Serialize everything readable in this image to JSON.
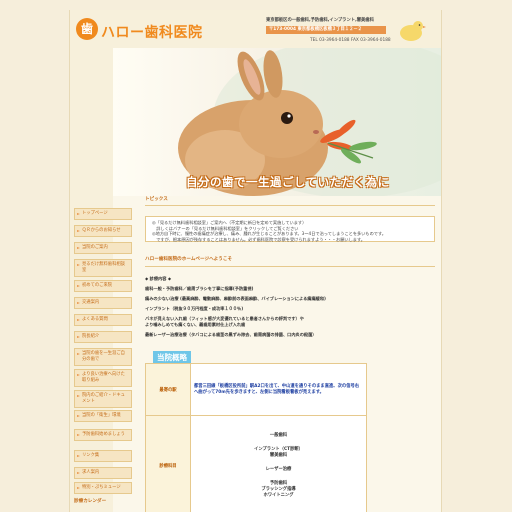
{
  "header": {
    "logo_glyph": "歯",
    "title": "ハロー歯科医院",
    "line1": "東京都板区の一般歯科,予防歯科,インプラント,審美歯科",
    "line2": "〒173-0004 東京都板橋区板橋３丁目１２－２",
    "line3": "TEL 03-3964-0188   FAX 03-3964-0188"
  },
  "hero": {
    "caption": "自分の歯で一生過ごしていただく為に"
  },
  "sidebar": {
    "items": [
      "トップページ",
      "ＱＲからのお知らせ",
      "当院のご案内",
      "見るだけ無料歯科相談室",
      "初めてのご来院",
      "交通案内",
      "よくある質問",
      "院長紹介",
      "当院の歯を一生涯ご自分の歯で",
      "より良い治療へ向けた取り組み",
      "院内のご紹介・ドキュメント",
      "当院の「衛生」環境",
      "予防歯科始めましょう",
      "リンク集",
      "求人案内",
      "特別・ぷちミュージ"
    ],
    "calendar_label": "診療カレンダー"
  },
  "main": {
    "topics_title": "トピックス",
    "topics_lines": [
      "◎「見るだけ無料歯科相談室」ご案内へ（不定期に新日を定めて実施しています）",
      "　詳しくはバナーの「見るだけ無料歯科相談室」をクリックしてご覧ください",
      "◎地方自下時に、慢性の歯痛症が治療し、痛み、腫れが生じることがあります。3〜4日で治ってしまうことを多いものです。",
      "　ですが、根本原因が残存することはありません。必ず歯科医院で診察を受けられますよう・・・お願いします。"
    ],
    "hello_title": "ハロー歯科医院のホームページへようこそ",
    "body_lines": [
      "◆ 診療内容 ◆",
      "歯科一般・予防歯科／歯周ブラシを丁寧に指導(予防重視)",
      "痛みの少ない治療 (最高麻酔、電動麻酔、麻酔前の表面麻酔、バイブレーションによる痛痛緩和)",
      "インプラント（税抜９０万円程度・成功率１００％)",
      "バネが見えない入れ歯（フィット感が大変優れていると患者さんからの評判です）や",
      "より噛みしめても痛くない、義歯用素材仕上げ入れ歯",
      "最新レーザー治療治療（タバコによる歯茎の黒ずみ除去、歯周病菌の排菌、口内炎の殺菌）"
    ],
    "table_title": "当院概略",
    "table": {
      "access_label": "最寄の駅",
      "access_value": "都営三田線「板橋区役所前」駅A2口を出て、中山道を通りそのまま直進、次の信号右へ曲がって70m先を歩きますと、左側に当院看板看板が見えます。",
      "dept_label": "診療科目",
      "dept_values": [
        "一般歯科",
        "インプラント（CT診断）",
        "審美歯科",
        "レーザー治療",
        "予防歯科",
        "ブラッシング指導",
        "ホワイトニング"
      ]
    }
  },
  "colors": {
    "accent": "#f08a1e",
    "accent_dark": "#c46c19",
    "background": "#f6eedb"
  }
}
